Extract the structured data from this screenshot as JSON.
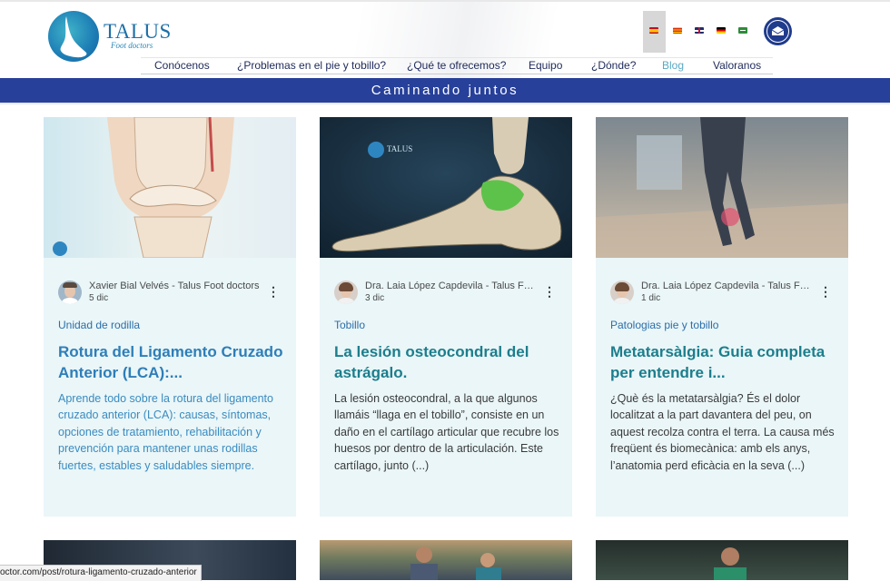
{
  "header": {
    "logo_name": "TALUS",
    "logo_subtitle": "Foot doctors"
  },
  "languages": [
    {
      "name": "es-flag-icon",
      "active": true
    },
    {
      "name": "ca-flag-icon",
      "active": false
    },
    {
      "name": "en-flag-icon",
      "active": false
    },
    {
      "name": "de-flag-icon",
      "active": false
    },
    {
      "name": "ar-flag-icon",
      "active": false
    }
  ],
  "nav": {
    "items": [
      "Conócenos",
      "¿Problemas en el pie y tobillo?",
      "¿Qué te ofrecemos?",
      "Equipo",
      "¿Dónde?",
      "Blog",
      "Valoranos"
    ],
    "active": "Blog"
  },
  "banner": {
    "text": "Caminando juntos"
  },
  "posts": [
    {
      "author": "Xavier Bial Velvés - Talus Foot doctors",
      "date": "5 dic",
      "category": "Unidad de rodilla",
      "title": "Rotura del Ligamento Cruzado Anterior (LCA):...",
      "excerpt": "Aprende todo sobre la rotura del ligamento cruzado anterior (LCA): causas, síntomas, opciones de tratamiento, rehabilitación y prevención para mantener unas rodillas fuertes, estables y saludables siempre."
    },
    {
      "author": "Dra. Laia López Capdevila - Talus Foot ...",
      "date": "3 dic",
      "category": "Tobillo",
      "title": "La lesión osteocondral del astrágalo.",
      "excerpt": "La lesión osteocondral, a la que algunos llamáis “llaga en el tobillo”, consiste en un daño en el cartílago articular que recubre los huesos por dentro de la articulación. Este cartílago, junto (...)"
    },
    {
      "author": "Dra. Laia López Capdevila - Talus Foot ...",
      "date": "1 dic",
      "category": "Patologias pie y tobillo",
      "title": "Metatarsàlgia: Guia completa per entendre i...",
      "excerpt": "¿Què és la metatarsàlgia? És el dolor localitzat a la part davantera del peu, on aquest recolza contra el terra. La causa més freqüent és biomecànica: amb els anys, l’anatomia perd eficàcia en la seva (...)"
    }
  ],
  "status_bar": {
    "url": "octor.com/post/rotura-ligamento-cruzado-anterior"
  },
  "colors": {
    "brand": "#27409a",
    "title_blue": "#2e7eb8",
    "title_teal": "#1c7e8c",
    "card_bg": "#eaf6f8"
  }
}
